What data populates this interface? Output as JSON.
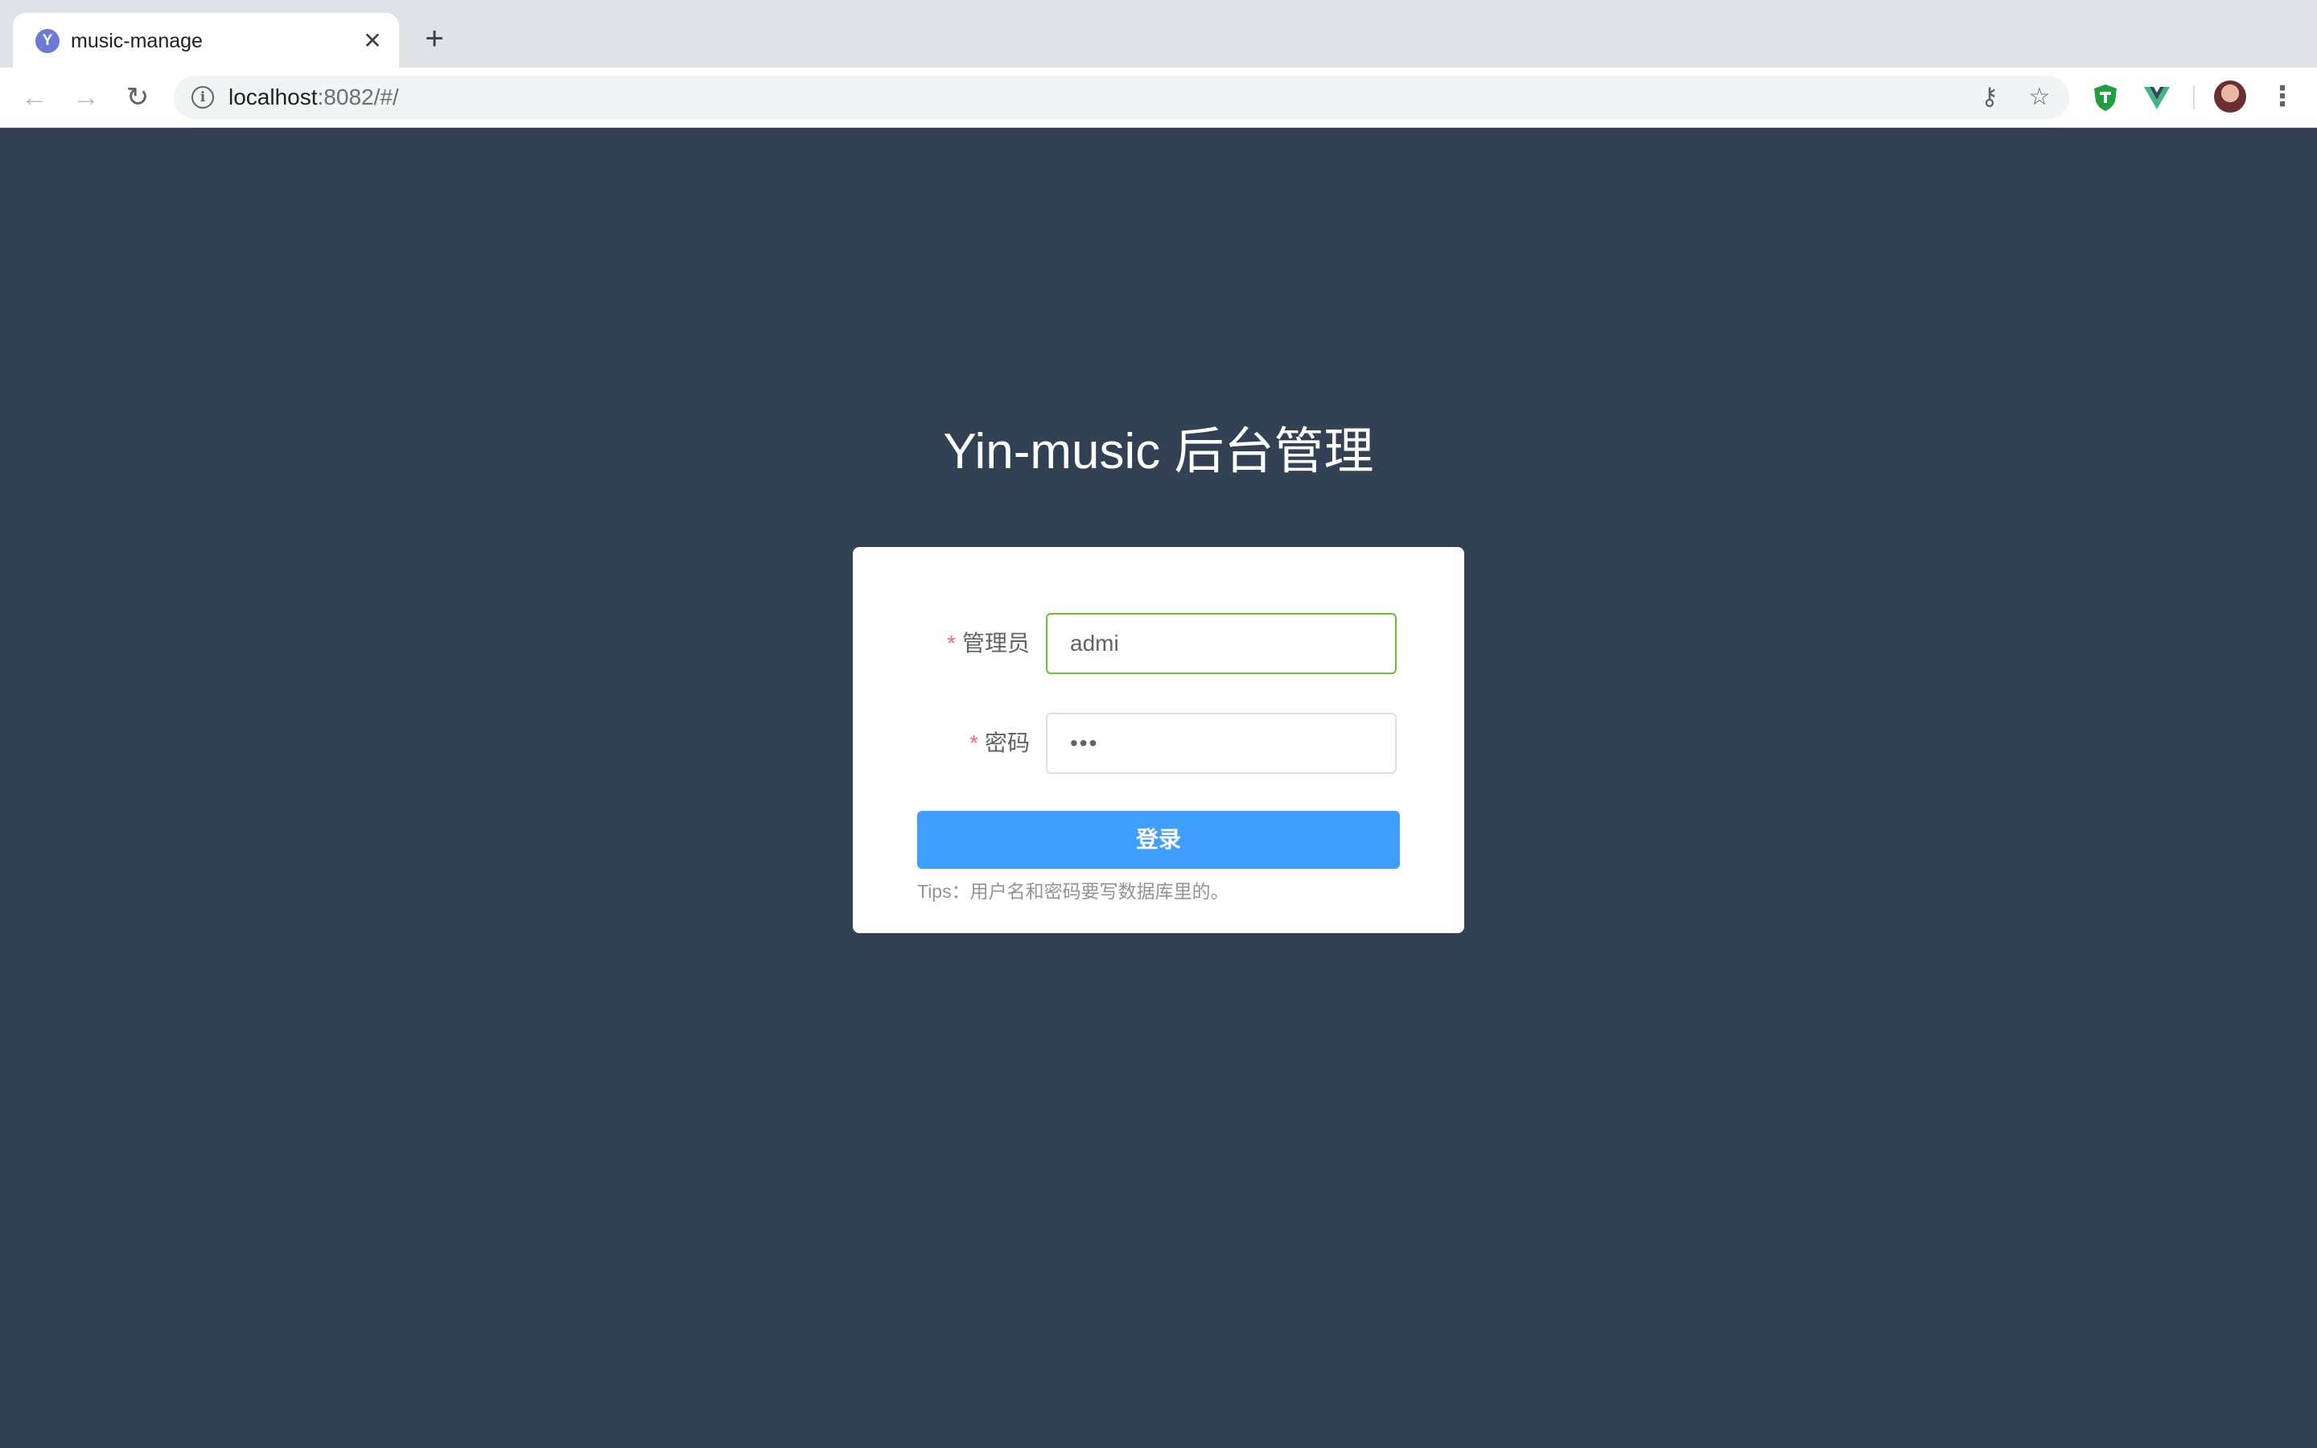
{
  "browser": {
    "tab_title": "music-manage",
    "favicon_letter": "Y",
    "close_glyph": "✕",
    "new_tab_glyph": "+",
    "url_host": "localhost",
    "url_path": ":8082/#/",
    "back_glyph": "←",
    "forward_glyph": "→",
    "reload_glyph": "↻",
    "key_glyph": "⚷",
    "star_glyph": "☆",
    "menu_glyph": "⋮",
    "info_glyph": "i",
    "icons": [
      "back-icon",
      "forward-icon",
      "reload-icon",
      "info-icon",
      "key-icon",
      "star-icon",
      "shield-extension-icon",
      "vue-devtools-icon",
      "profile-avatar",
      "menu-icon"
    ]
  },
  "page": {
    "title": "Yin-music 后台管理",
    "background_color": "#334155"
  },
  "form": {
    "required_mark": "*",
    "username_label": "管理员",
    "username_value": "admi",
    "password_label": "密码",
    "password_value": "•••",
    "login_label": "登录",
    "tips": "Tips：用户名和密码要写数据库里的。",
    "colors": {
      "primary": "#409eff",
      "focus_border": "#67c23a",
      "required": "#f56c6c"
    }
  }
}
